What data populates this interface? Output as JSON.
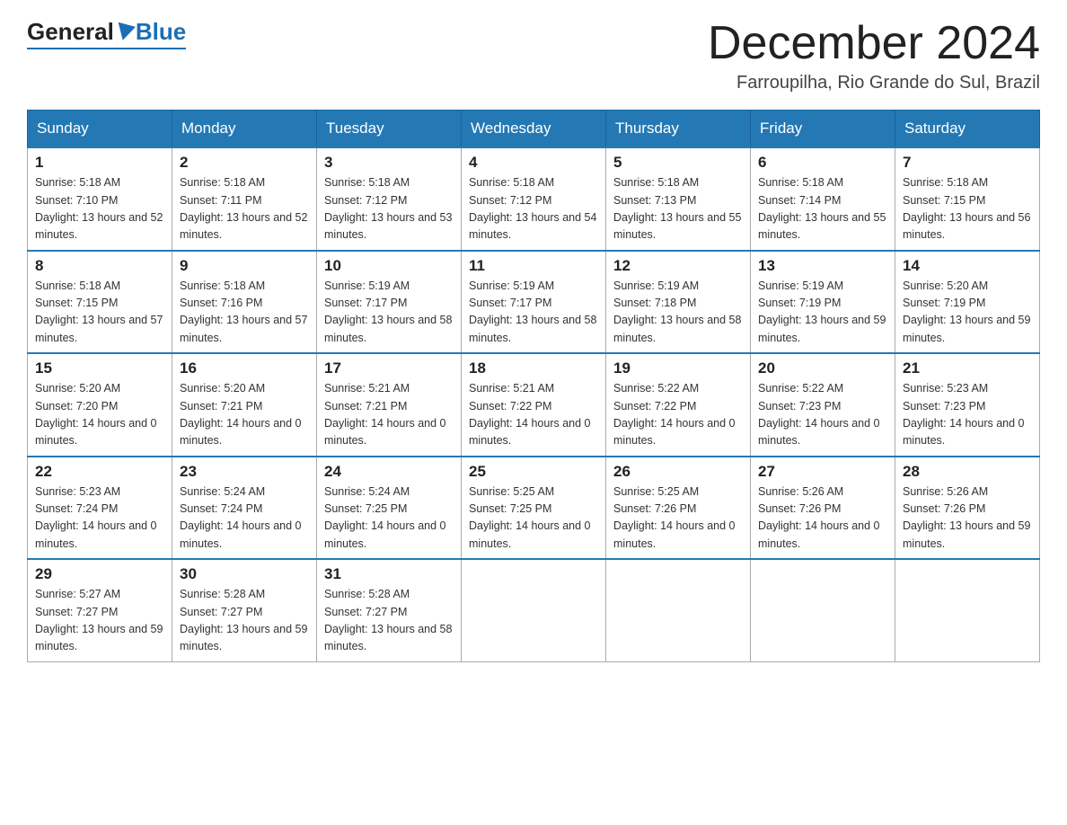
{
  "header": {
    "logo_general": "General",
    "logo_blue": "Blue",
    "month_title": "December 2024",
    "location": "Farroupilha, Rio Grande do Sul, Brazil"
  },
  "weekdays": [
    "Sunday",
    "Monday",
    "Tuesday",
    "Wednesday",
    "Thursday",
    "Friday",
    "Saturday"
  ],
  "weeks": [
    [
      {
        "day": "1",
        "sunrise": "5:18 AM",
        "sunset": "7:10 PM",
        "daylight": "13 hours and 52 minutes."
      },
      {
        "day": "2",
        "sunrise": "5:18 AM",
        "sunset": "7:11 PM",
        "daylight": "13 hours and 52 minutes."
      },
      {
        "day": "3",
        "sunrise": "5:18 AM",
        "sunset": "7:12 PM",
        "daylight": "13 hours and 53 minutes."
      },
      {
        "day": "4",
        "sunrise": "5:18 AM",
        "sunset": "7:12 PM",
        "daylight": "13 hours and 54 minutes."
      },
      {
        "day": "5",
        "sunrise": "5:18 AM",
        "sunset": "7:13 PM",
        "daylight": "13 hours and 55 minutes."
      },
      {
        "day": "6",
        "sunrise": "5:18 AM",
        "sunset": "7:14 PM",
        "daylight": "13 hours and 55 minutes."
      },
      {
        "day": "7",
        "sunrise": "5:18 AM",
        "sunset": "7:15 PM",
        "daylight": "13 hours and 56 minutes."
      }
    ],
    [
      {
        "day": "8",
        "sunrise": "5:18 AM",
        "sunset": "7:15 PM",
        "daylight": "13 hours and 57 minutes."
      },
      {
        "day": "9",
        "sunrise": "5:18 AM",
        "sunset": "7:16 PM",
        "daylight": "13 hours and 57 minutes."
      },
      {
        "day": "10",
        "sunrise": "5:19 AM",
        "sunset": "7:17 PM",
        "daylight": "13 hours and 58 minutes."
      },
      {
        "day": "11",
        "sunrise": "5:19 AM",
        "sunset": "7:17 PM",
        "daylight": "13 hours and 58 minutes."
      },
      {
        "day": "12",
        "sunrise": "5:19 AM",
        "sunset": "7:18 PM",
        "daylight": "13 hours and 58 minutes."
      },
      {
        "day": "13",
        "sunrise": "5:19 AM",
        "sunset": "7:19 PM",
        "daylight": "13 hours and 59 minutes."
      },
      {
        "day": "14",
        "sunrise": "5:20 AM",
        "sunset": "7:19 PM",
        "daylight": "13 hours and 59 minutes."
      }
    ],
    [
      {
        "day": "15",
        "sunrise": "5:20 AM",
        "sunset": "7:20 PM",
        "daylight": "14 hours and 0 minutes."
      },
      {
        "day": "16",
        "sunrise": "5:20 AM",
        "sunset": "7:21 PM",
        "daylight": "14 hours and 0 minutes."
      },
      {
        "day": "17",
        "sunrise": "5:21 AM",
        "sunset": "7:21 PM",
        "daylight": "14 hours and 0 minutes."
      },
      {
        "day": "18",
        "sunrise": "5:21 AM",
        "sunset": "7:22 PM",
        "daylight": "14 hours and 0 minutes."
      },
      {
        "day": "19",
        "sunrise": "5:22 AM",
        "sunset": "7:22 PM",
        "daylight": "14 hours and 0 minutes."
      },
      {
        "day": "20",
        "sunrise": "5:22 AM",
        "sunset": "7:23 PM",
        "daylight": "14 hours and 0 minutes."
      },
      {
        "day": "21",
        "sunrise": "5:23 AM",
        "sunset": "7:23 PM",
        "daylight": "14 hours and 0 minutes."
      }
    ],
    [
      {
        "day": "22",
        "sunrise": "5:23 AM",
        "sunset": "7:24 PM",
        "daylight": "14 hours and 0 minutes."
      },
      {
        "day": "23",
        "sunrise": "5:24 AM",
        "sunset": "7:24 PM",
        "daylight": "14 hours and 0 minutes."
      },
      {
        "day": "24",
        "sunrise": "5:24 AM",
        "sunset": "7:25 PM",
        "daylight": "14 hours and 0 minutes."
      },
      {
        "day": "25",
        "sunrise": "5:25 AM",
        "sunset": "7:25 PM",
        "daylight": "14 hours and 0 minutes."
      },
      {
        "day": "26",
        "sunrise": "5:25 AM",
        "sunset": "7:26 PM",
        "daylight": "14 hours and 0 minutes."
      },
      {
        "day": "27",
        "sunrise": "5:26 AM",
        "sunset": "7:26 PM",
        "daylight": "14 hours and 0 minutes."
      },
      {
        "day": "28",
        "sunrise": "5:26 AM",
        "sunset": "7:26 PM",
        "daylight": "13 hours and 59 minutes."
      }
    ],
    [
      {
        "day": "29",
        "sunrise": "5:27 AM",
        "sunset": "7:27 PM",
        "daylight": "13 hours and 59 minutes."
      },
      {
        "day": "30",
        "sunrise": "5:28 AM",
        "sunset": "7:27 PM",
        "daylight": "13 hours and 59 minutes."
      },
      {
        "day": "31",
        "sunrise": "5:28 AM",
        "sunset": "7:27 PM",
        "daylight": "13 hours and 58 minutes."
      },
      null,
      null,
      null,
      null
    ]
  ],
  "labels": {
    "sunrise": "Sunrise:",
    "sunset": "Sunset:",
    "daylight": "Daylight:"
  }
}
